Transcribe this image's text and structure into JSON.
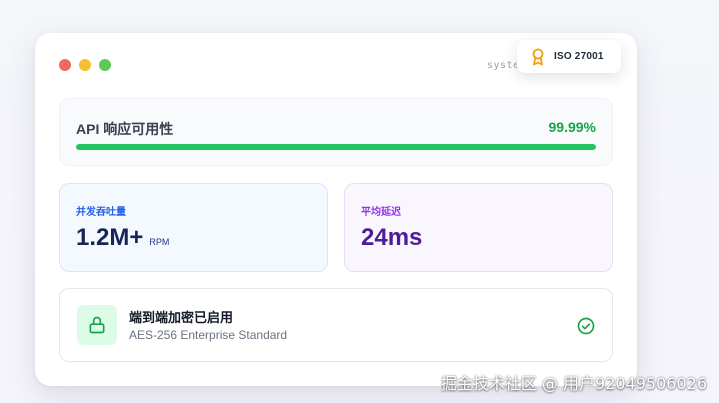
{
  "window": {
    "system_label": "syste"
  },
  "badge": {
    "icon": "award-ribbon-icon",
    "text": "ISO 27001",
    "accent_color": "#f59e0b"
  },
  "uptime": {
    "label": "API 响应可用性",
    "value": "99.99%",
    "progress_fraction": 0.9999,
    "color": "#22c55e"
  },
  "metrics": [
    {
      "label": "并发吞吐量",
      "value": "1.2M+",
      "unit": "RPM",
      "color": "#2563eb"
    },
    {
      "label": "平均延迟",
      "value": "24ms",
      "unit": "",
      "color": "#9333ea"
    }
  ],
  "encryption": {
    "icon": "lock-icon",
    "title": "端到端加密已启用",
    "subtitle": "AES-256 Enterprise Standard",
    "status_icon": "check-circle-icon",
    "color": "#16a34a"
  },
  "watermark": "掘金技术社区 @ 用户92049506026"
}
